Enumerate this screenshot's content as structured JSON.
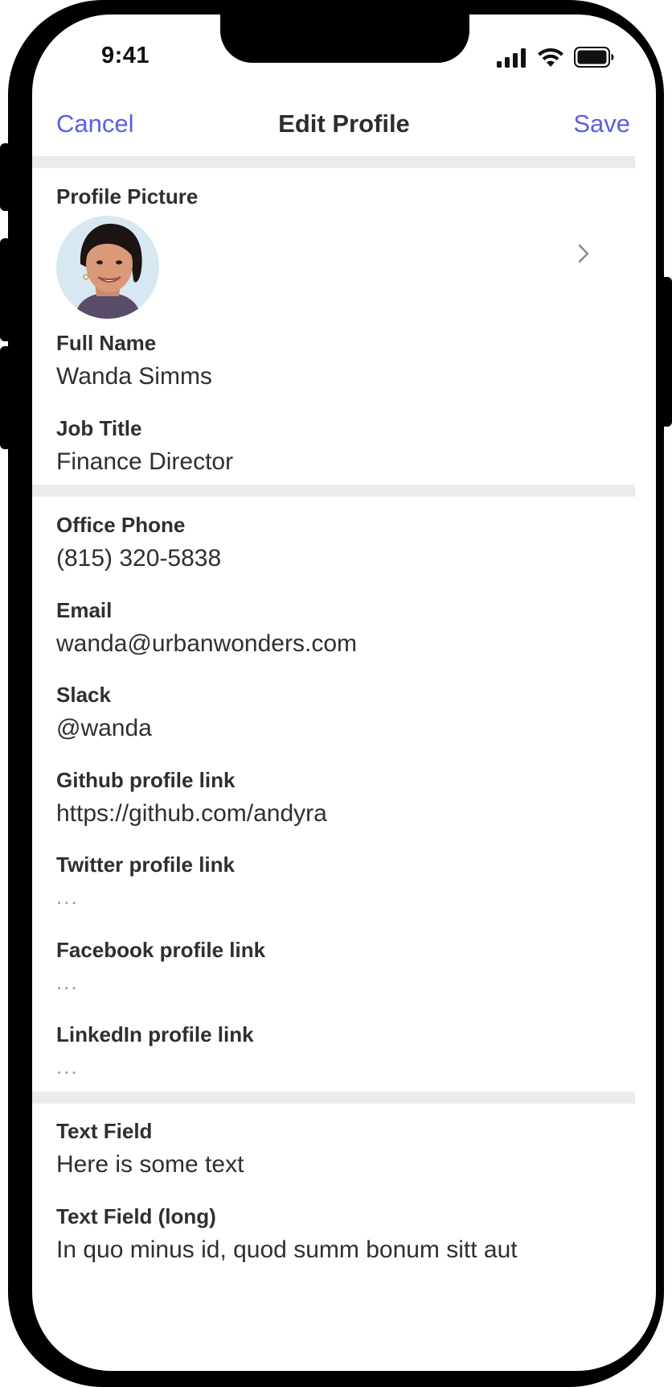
{
  "status_bar": {
    "time": "9:41"
  },
  "nav": {
    "cancel_label": "Cancel",
    "title": "Edit Profile",
    "save_label": "Save",
    "accent_color": "#5b5fe0"
  },
  "profile": {
    "picture_label": "Profile Picture",
    "fields": [
      {
        "label": "Full Name",
        "value": "Wanda Simms"
      },
      {
        "label": "Job Title",
        "value": "Finance Director"
      },
      {
        "label": "Office Phone",
        "value": "(815) 320-5838"
      },
      {
        "label": "Email",
        "value": "wanda@urbanwonders.com"
      },
      {
        "label": "Slack",
        "value": "@wanda"
      },
      {
        "label": "Github profile link",
        "value": "https://github.com/andyra"
      },
      {
        "label": "Twitter profile link",
        "placeholder": "..."
      },
      {
        "label": "Facebook profile link",
        "placeholder": "..."
      },
      {
        "label": "LinkedIn profile link",
        "placeholder": "..."
      },
      {
        "label": "Text Field",
        "value": "Here is some text"
      },
      {
        "label": "Text Field (long)",
        "value": "In quo minus id, quod summ bonum sitt aut"
      }
    ]
  },
  "icons": {
    "signal": "cellular-signal-icon",
    "wifi": "wifi-icon",
    "battery": "battery-icon",
    "chevron": "chevron-right-icon"
  }
}
